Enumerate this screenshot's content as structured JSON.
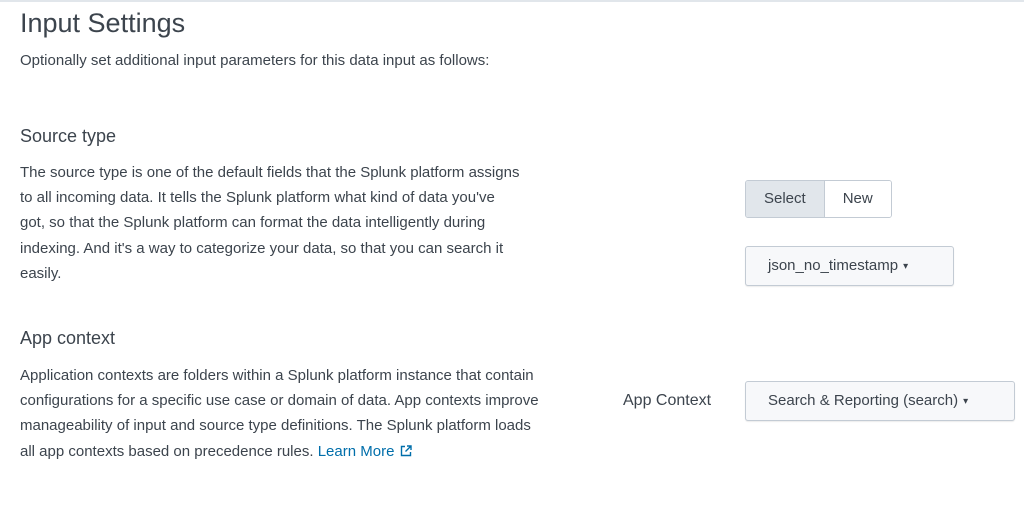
{
  "page": {
    "title": "Input Settings",
    "subtitle": "Optionally set additional input parameters for this data input as follows:"
  },
  "source_type": {
    "title": "Source type",
    "description": "The source type is one of the default fields that the Splunk platform assigns to all incoming data. It tells the Splunk platform what kind of data you've got, so that the Splunk platform can format the data intelligently during indexing. And it's a way to categorize your data, so that you can search it easily.",
    "toggle": {
      "options": [
        "Select",
        "New"
      ],
      "selected": "Select"
    },
    "dropdown_value": "json_no_timestamp",
    "caret": "▾"
  },
  "app_context": {
    "title": "App context",
    "description": "Application contexts are folders within a Splunk platform instance that contain configurations for a specific use case or domain of data. App contexts improve manageability of input and source type definitions. The Splunk platform loads all app contexts based on precedence rules.",
    "learn_more": "Learn More",
    "field_label": "App Context",
    "dropdown_value": "Search & Reporting (search)",
    "caret": "▾"
  },
  "colors": {
    "text": "#3c444d",
    "link": "#006eaa",
    "border": "#c3cbd4",
    "active_segment": "#e1e6eb"
  },
  "icons": {
    "external_link": "external-link-icon",
    "caret": "caret-down-icon"
  }
}
